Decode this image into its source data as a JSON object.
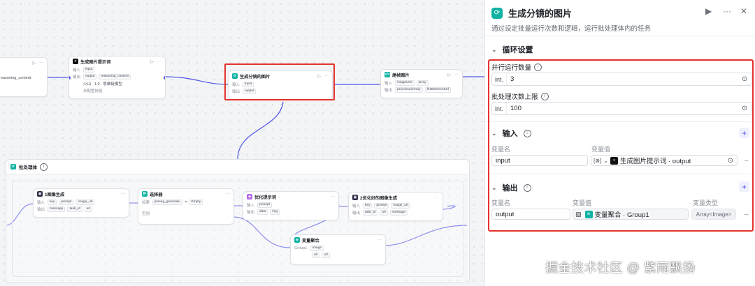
{
  "canvas": {
    "node_partial": {
      "title": "",
      "row_label": "",
      "value": "easoning_content"
    },
    "node_prompt": {
      "title": "生成图片提示词",
      "rows": [
        {
          "label": "输入",
          "chips": [
            "input"
          ]
        },
        {
          "label": "输出",
          "chips": [
            "output",
            "reasoning_content"
          ]
        },
        {
          "label": "",
          "text": "火山 · 1.0 · 思维链模型"
        },
        {
          "label": "",
          "text": "未配置技能"
        }
      ]
    },
    "node_gen_split": {
      "title": "生成分镜的图片",
      "rows": [
        {
          "label": "输入",
          "chips": [
            "input"
          ]
        },
        {
          "label": "输出",
          "chips": [
            "output"
          ]
        }
      ]
    },
    "node_tail": {
      "title": "尾帧图片",
      "rows": [
        {
          "label": "输入",
          "chips": [
            "imageUrls",
            "array"
          ]
        },
        {
          "label": "输出",
          "chips": [
            "processedArray",
            "firstElementUrl"
          ]
        }
      ]
    },
    "batch": {
      "title": "批处理体"
    },
    "node_img1": {
      "title": "1图像生成",
      "rows": [
        {
          "label": "输入",
          "chips": [
            "key",
            "prompt",
            "image_url"
          ]
        },
        {
          "label": "输出",
          "chips": [
            "message",
            "task_id",
            "url"
          ]
        }
      ]
    },
    "node_selector": {
      "title": "选择器",
      "if_label": "如果",
      "cond_left": "jimeng_generate-",
      "cond_op": "=",
      "cond_right": "Empty",
      "else_label": "否则"
    },
    "node_optimize": {
      "title": "优化提示词",
      "rows": [
        {
          "label": "输入",
          "chips": [
            "prompt"
          ]
        },
        {
          "label": "输出",
          "chips": [
            "data",
            "img"
          ]
        }
      ]
    },
    "node_img2": {
      "title": "2优化好的图像生成",
      "rows": [
        {
          "label": "输入",
          "chips": [
            "key",
            "prompt",
            "image_url"
          ]
        },
        {
          "label": "输出",
          "chips": [
            "task_id",
            "url",
            "message"
          ]
        }
      ]
    },
    "node_merge": {
      "title": "变量聚合",
      "group_label": "Group1",
      "chips": [
        "image",
        "url",
        "url"
      ]
    }
  },
  "panel": {
    "title": "生成分镜的图片",
    "description": "通过设定批量运行次数和逻辑，运行批处理体内的任务",
    "loop_section": "循环设置",
    "parallel_label": "并行运行数量",
    "parallel_prefix": "int.",
    "parallel_value": "3",
    "batch_limit_label": "批处理次数上限",
    "batch_limit_prefix": "int.",
    "batch_limit_value": "100",
    "input_section": "输入",
    "input_col_name": "变量名",
    "input_col_value": "变量值",
    "input_var_name": "input",
    "input_var_value": "生成图片提示词 · output",
    "output_section": "输出",
    "output_col_name": "变量名",
    "output_col_value": "变量值",
    "output_col_type": "变量类型",
    "output_var_name": "output",
    "output_var_value": "变量聚合 · Group1",
    "output_var_type": "Array<Image>"
  },
  "watermark": "掘金技术社区 @ 紫雨飘扬",
  "colors": {
    "accent": "#4d53e8",
    "teal": "#10b3a3",
    "highlight": "#e5322d"
  }
}
